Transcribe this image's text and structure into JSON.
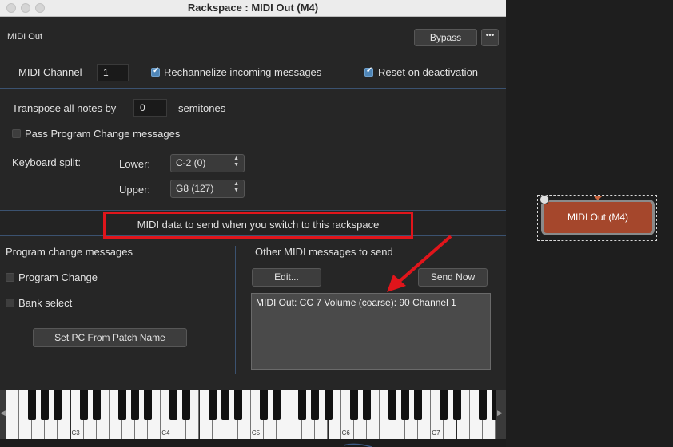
{
  "window": {
    "title": "Rackspace : MIDI Out (M4)"
  },
  "header": {
    "plugin_name": "MIDI Out",
    "bypass_label": "Bypass",
    "more_label": "•••"
  },
  "channel": {
    "label": "MIDI Channel",
    "value": "1",
    "rechannelize_label": "Rechannelize incoming messages",
    "rechannelize_checked": true,
    "reset_label": "Reset on deactivation",
    "reset_checked": true
  },
  "transpose": {
    "label": "Transpose all notes by",
    "value": "0",
    "unit": "semitones"
  },
  "pass_program_change": {
    "label": "Pass Program Change messages",
    "checked": false
  },
  "keyboard_split": {
    "label": "Keyboard split:",
    "lower_label": "Lower:",
    "lower_value": "C-2 (0)",
    "upper_label": "Upper:",
    "upper_value": "G8 (127)"
  },
  "midi_data_banner": "MIDI data to send when you switch to this rackspace",
  "program_change": {
    "heading": "Program change messages",
    "program_change_label": "Program Change",
    "program_change_checked": false,
    "bank_select_label": "Bank select",
    "bank_select_checked": false,
    "set_pc_label": "Set PC From Patch Name"
  },
  "other_midi": {
    "heading": "Other MIDI messages to send",
    "edit_label": "Edit...",
    "send_now_label": "Send Now",
    "messages": "MIDI Out: CC 7 Volume (coarse): 90 Channel 1"
  },
  "piano": {
    "octave_labels": [
      "C3",
      "C4",
      "C5",
      "C6",
      "C7"
    ]
  },
  "node": {
    "label": "MIDI Out (M4)"
  },
  "colors": {
    "highlight_red": "#e0151b",
    "node_fill": "#a5472c",
    "accent_blue": "#4f86b8"
  }
}
